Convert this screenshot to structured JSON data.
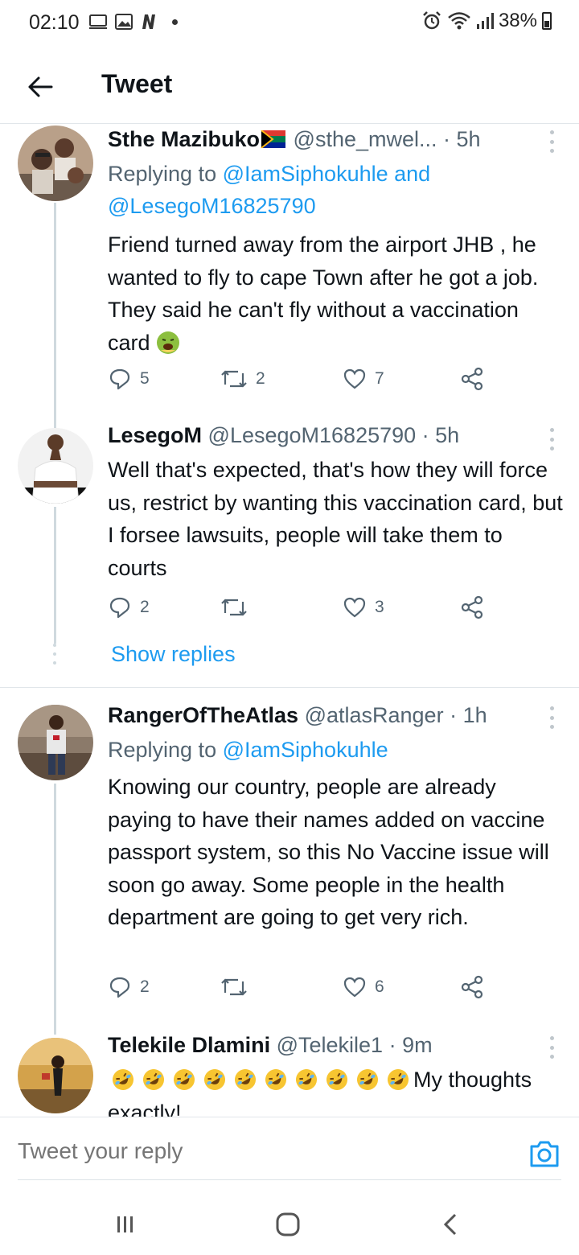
{
  "status_bar": {
    "time": "02:10",
    "battery": "38%"
  },
  "header": {
    "title": "Tweet"
  },
  "tweets": [
    {
      "name": "Sthe Mazibuko",
      "handle": "@sthe_mwel...",
      "time": "· 5h",
      "replying_prefix": "Replying to ",
      "replying_to": "@IamSiphokuhle and",
      "replying_to_2": "@LesegoM16825790",
      "text": "Friend turned away from the airport JHB , he wanted to fly to cape Town after he got a job. They said he can't fly without a vaccination card",
      "replies": "5",
      "retweets": "2",
      "likes": "7"
    },
    {
      "name": "LesegoM",
      "handle": "@LesegoM16825790",
      "time": "· 5h",
      "text": "Well that's expected, that's how they will force us, restrict by wanting this vaccination card, but I forsee lawsuits, people will take them to courts",
      "replies": "2",
      "retweets": "",
      "likes": "3"
    },
    {
      "name": "RangerOfTheAtlas",
      "handle": "@atlasRanger",
      "time": "· 1h",
      "replying_prefix": "Replying to ",
      "replying_to": "@IamSiphokuhle",
      "text": "Knowing our country, people are already paying to have their names added on vaccine passport system, so this No Vaccine issue will soon go away.  Some people in the health department are going to get very rich.",
      "replies": "2",
      "retweets": "",
      "likes": "6"
    },
    {
      "name": "Telekile Dlamini",
      "handle": "@Telekile1",
      "time": "· 9m",
      "text": "My thoughts exactly!"
    }
  ],
  "show_replies": "Show replies",
  "reply_bar": {
    "placeholder": "Tweet your reply"
  },
  "colors": {
    "accent": "#1d9bf0",
    "muted": "#536471",
    "text": "#0f1419"
  },
  "icons": {
    "flag": "south-africa-flag-icon",
    "emoji_sick": "nauseated-face-icon",
    "emoji_laugh": "rolling-on-floor-laughing-icon"
  }
}
